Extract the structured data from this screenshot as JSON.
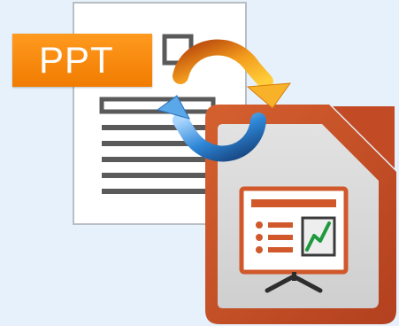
{
  "document": {
    "badge_label": "PPT"
  },
  "colors": {
    "background": "#e6f1fb",
    "badge_orange": "#f39200",
    "impress_frame": "#c9512a",
    "arrow_orange": "#f7a21b",
    "arrow_blue": "#2e86d6",
    "chart_line": "#1e9a3c"
  },
  "icons": {
    "source": "ppt-document-icon",
    "conversion": "circular-arrows-icon",
    "target": "libreoffice-impress-icon"
  }
}
